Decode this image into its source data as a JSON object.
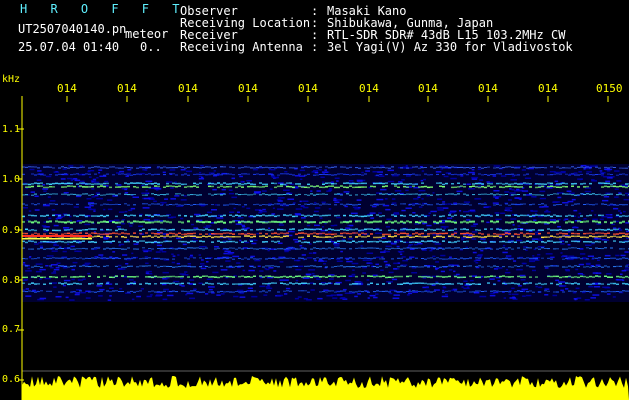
{
  "app": {
    "title": "H R O F F T",
    "file_name": "UT2507040140.pn",
    "file_suffix": "meteor",
    "datetime": "25.07.04 01:40",
    "datetime_extra": "0.."
  },
  "info": [
    {
      "key": "Observer",
      "value": "Masaki Kano"
    },
    {
      "key": "Receiving Location",
      "value": "Shibukawa, Gunma, Japan"
    },
    {
      "key": "Receiver",
      "value": "RTL-SDR SDR# 43dB L15 103.2MHz CW"
    },
    {
      "key": "Receiving Antenna",
      "value": "3el Yagi(V) Az 330 for Vladivostok"
    }
  ],
  "y_axis": {
    "unit": "kHz",
    "ticks": [
      "1.1",
      "1.0",
      "0.9",
      "0.8",
      "0.7",
      "0.6"
    ]
  },
  "x_axis": {
    "ticks": [
      "014",
      "014",
      "014",
      "014",
      "014",
      "014",
      "014",
      "014",
      "014",
      "0150"
    ]
  },
  "colors": {
    "title": "#5ff0ff",
    "text": "#ffffff",
    "axis": "#ffff00",
    "background": "#000000",
    "spectrum_base": "#000080"
  }
}
